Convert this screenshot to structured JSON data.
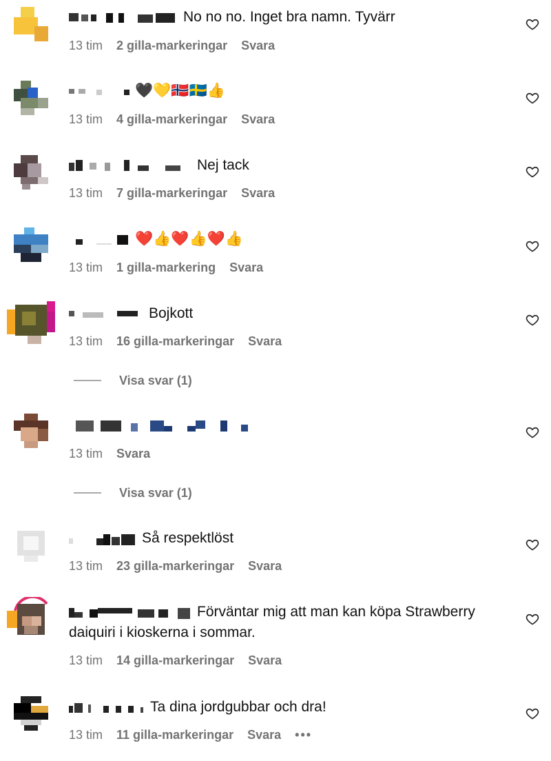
{
  "comments": [
    {
      "text": "No no no. Inget bra namn. Tyvärr",
      "time": "13 tim",
      "likes": "2 gilla-markeringar",
      "reply": "Svara"
    },
    {
      "text": "🖤💛🇳🇴🇸🇪👍",
      "time": "13 tim",
      "likes": "4 gilla-markeringar",
      "reply": "Svara"
    },
    {
      "text": "Nej tack",
      "time": "13 tim",
      "likes": "7 gilla-markeringar",
      "reply": "Svara"
    },
    {
      "text": "❤️👍❤️👍❤️👍",
      "time": "13 tim",
      "likes": "1 gilla-markering",
      "reply": "Svara"
    },
    {
      "text": "Bojkott",
      "time": "13 tim",
      "likes": "16 gilla-markeringar",
      "reply": "Svara",
      "view_replies": "Visa svar (1)"
    },
    {
      "text": "",
      "time": "13 tim",
      "likes": "",
      "reply": "Svara",
      "view_replies": "Visa svar (1)"
    },
    {
      "text": "Så respektlöst",
      "time": "13 tim",
      "likes": "23 gilla-markeringar",
      "reply": "Svara"
    },
    {
      "text": "Förväntar mig att man kan köpa Strawberry daiquiri i kioskerna i sommar.",
      "time": "13 tim",
      "likes": "14 gilla-markeringar",
      "reply": "Svara"
    },
    {
      "text": "Ta dina jordgubbar och dra!",
      "time": "13 tim",
      "likes": "11 gilla-markeringar",
      "reply": "Svara",
      "more": "•••"
    }
  ],
  "icons": {
    "like": "heart-outline-icon",
    "more": "more-horizontal-icon"
  },
  "colors": {
    "meta": "#737373",
    "text": "#111111",
    "divider": "#a8a8a8"
  }
}
